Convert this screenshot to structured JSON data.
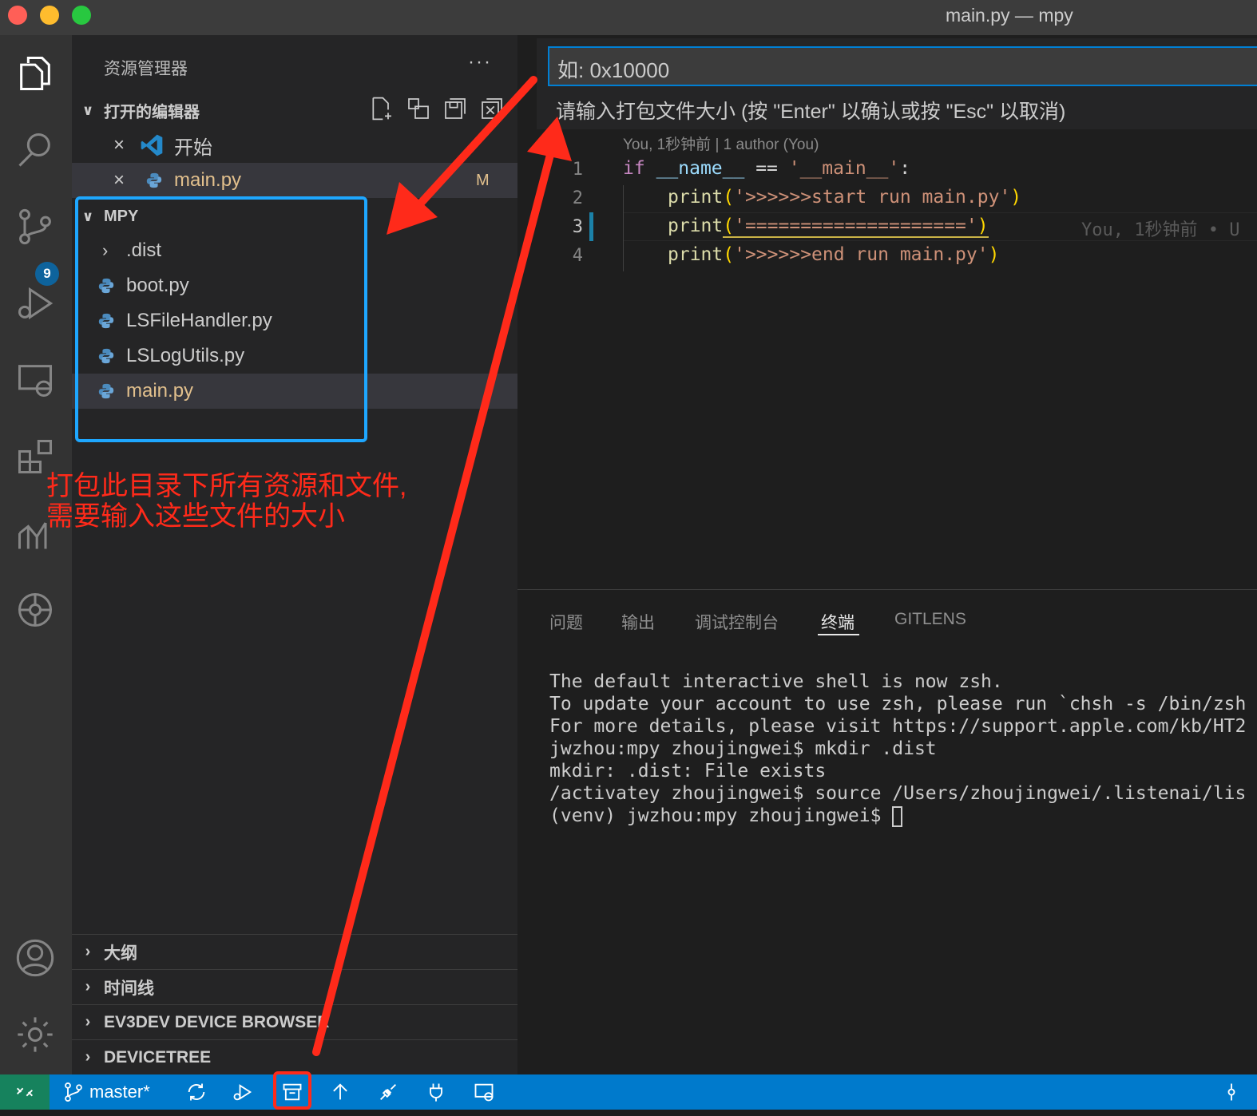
{
  "window": {
    "title": "main.py — mpy"
  },
  "activity": {
    "scm_badge": "9"
  },
  "sidebar": {
    "title": "资源管理器",
    "more": "···",
    "open_editors": {
      "header": "打开的编辑器",
      "items": [
        {
          "label": "开始",
          "close": "×"
        },
        {
          "label": "main.py",
          "close": "×",
          "status": "M"
        }
      ]
    },
    "folder": {
      "header": "MPY",
      "items": [
        {
          "label": ".dist"
        },
        {
          "label": "boot.py"
        },
        {
          "label": "LSFileHandler.py"
        },
        {
          "label": "LSLogUtils.py"
        },
        {
          "label": "main.py"
        }
      ]
    },
    "bottom_sections": [
      "大纲",
      "时间线",
      "EV3DEV DEVICE BROWSER",
      "DEVICETREE"
    ]
  },
  "annotation": {
    "text": "打包此目录下所有资源和文件,\n需要输入这些文件的大小"
  },
  "quick_input": {
    "value": "如: 0x10000",
    "message": "请输入打包文件大小 (按 \"Enter\" 以确认或按 \"Esc\" 以取消)"
  },
  "editor": {
    "blame_header": "You, 1秒钟前 | 1 author (You)",
    "line_numbers": [
      "1",
      "2",
      "3",
      "4"
    ],
    "inline_blame": "You, 1秒钟前 • U",
    "lines": {
      "l1_kw": "if",
      "l1_name": "__name__",
      "l1_op": " == ",
      "l1_str": "'__main__'",
      "l1_colon": ":",
      "fn": "print",
      "l2_str": "'>>>>>>start run main.py'",
      "l3_str": "'===================='",
      "l4_str": "'>>>>>>end run main.py'"
    }
  },
  "panel": {
    "tabs": [
      "问题",
      "输出",
      "调试控制台",
      "终端",
      "GITLENS"
    ],
    "active_tab": "终端",
    "terminal_lines": [
      "The default interactive shell is now zsh.",
      "To update your account to use zsh, please run `chsh -s /bin/zsh",
      "For more details, please visit https://support.apple.com/kb/HT2",
      "jwzhou:mpy zhoujingwei$ mkdir .dist",
      "mkdir: .dist: File exists",
      "/activatey zhoujingwei$ source /Users/zhoujingwei/.listenai/lis",
      "(venv) jwzhou:mpy zhoujingwei$ "
    ]
  },
  "statusbar": {
    "branch": "master*"
  },
  "colors": {
    "status_bar": "#007acc",
    "remote": "#16825d",
    "annotation_red": "#ff2a1a",
    "annotation_blue": "#1ea7ff"
  }
}
